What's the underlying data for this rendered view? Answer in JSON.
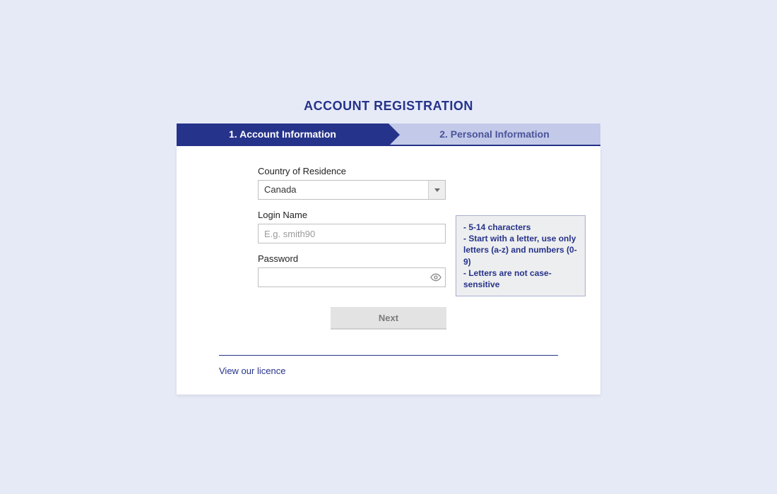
{
  "title": "ACCOUNT REGISTRATION",
  "stepper": {
    "step1": "1. Account Information",
    "step2": "2. Personal Information"
  },
  "form": {
    "country": {
      "label": "Country of Residence",
      "value": "Canada"
    },
    "login": {
      "label": "Login Name",
      "placeholder": "E.g. smith90",
      "value": ""
    },
    "password": {
      "label": "Password",
      "value": ""
    },
    "hints": {
      "line1": "- 5-14 characters",
      "line2": "- Start with a letter, use only letters (a-z) and numbers (0-9)",
      "line3": "- Letters are not case-sensitive"
    },
    "next_button": "Next"
  },
  "footer": {
    "licence_link": "View our licence"
  }
}
